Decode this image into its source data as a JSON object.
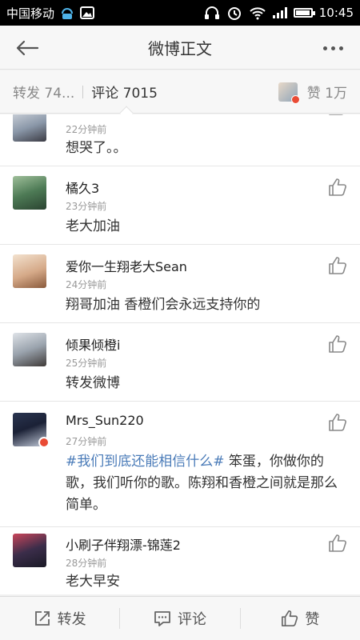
{
  "status": {
    "carrier": "中国移动",
    "time": "10:45",
    "battery_level": 0.85,
    "icons": [
      "usb-icon",
      "image-icon",
      "headphones-icon",
      "alarm-icon",
      "wifi-icon",
      "signal-icon",
      "battery-icon"
    ]
  },
  "nav": {
    "title": "微博正文",
    "back_icon": "arrow-left-icon",
    "more_icon": "more-icon"
  },
  "tabs": {
    "repost": "转发 74...",
    "comment": "评论 7015",
    "like": "赞 1万"
  },
  "comments": [
    {
      "name": "",
      "time": "22分钟前",
      "text": "想哭了。。"
    },
    {
      "name": "橘久3",
      "time": "23分钟前",
      "text": "老大加油"
    },
    {
      "name": "爱你一生翔老大Sean",
      "time": "24分钟前",
      "text": "翔哥加油  香橙们会永远支持你的"
    },
    {
      "name": "倾果倾橙i",
      "time": "25分钟前",
      "text": "转发微博"
    },
    {
      "name": "Mrs_Sun220",
      "time": "27分钟前",
      "hashtag": "#我们到底还能相信什么#",
      "text": " 笨蛋，你做你的歌，我们听你的歌。陈翔和香橙之间就是那么简单。"
    },
    {
      "name": "小刷子伴翔漂-锦莲2",
      "time": "28分钟前",
      "text": "老大早安"
    }
  ],
  "bottom": {
    "repost": "转发",
    "comment": "评论",
    "like": "赞"
  },
  "colors": {
    "hashtag": "#4a7bb8",
    "badge": "#e94b35"
  }
}
